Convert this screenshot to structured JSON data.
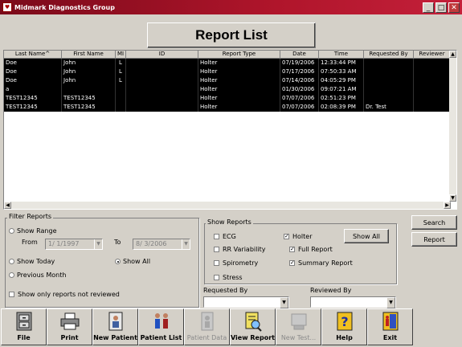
{
  "window": {
    "title": "Midmark Diagnostics Group"
  },
  "page_title": "Report List",
  "grid": {
    "columns": [
      "Last Name^",
      "First Name",
      "MI",
      "ID",
      "Report Type",
      "Date",
      "Time",
      "Requested By",
      "Reviewer"
    ],
    "rows": [
      [
        "Doe",
        "John",
        "L",
        "",
        "Holter",
        "07/19/2006",
        "12:33:44 PM",
        "",
        ""
      ],
      [
        "Doe",
        "John",
        "L",
        "",
        "Holter",
        "07/17/2006",
        "07:50:33 AM",
        "",
        ""
      ],
      [
        "Doe",
        "John",
        "L",
        "",
        "Holter",
        "07/14/2006",
        "04:05:29 PM",
        "",
        ""
      ],
      [
        "a",
        "",
        "",
        "",
        "Holter",
        "01/30/2006",
        "09:07:21 AM",
        "",
        ""
      ],
      [
        "TEST12345",
        "TEST12345",
        "",
        "",
        "Holter",
        "07/07/2006",
        "02:51:23 PM",
        "",
        ""
      ],
      [
        "TEST12345",
        "TEST12345",
        "",
        "",
        "Holter",
        "07/07/2006",
        "02:08:39 PM",
        "Dr. Test",
        ""
      ]
    ]
  },
  "filter": {
    "legend": "Filter Reports",
    "show_range": "Show Range",
    "from_label": "From",
    "from_value": "1/ 1/1997",
    "to_label": "To",
    "to_value": "8/ 3/2006",
    "show_today": "Show Today",
    "show_all": "Show All",
    "previous_month": "Previous Month",
    "not_reviewed": "Show only reports not reviewed"
  },
  "show_reports": {
    "legend": "Show Reports",
    "ecg": "ECG",
    "rr": "RR Variability",
    "spirometry": "Spirometry",
    "stress": "Stress",
    "holter": "Holter",
    "full_report": "Full Report",
    "summary_report": "Summary Report",
    "show_all_button": "Show All"
  },
  "requested_by": {
    "label": "Requested By",
    "value": ""
  },
  "reviewed_by": {
    "label": "Reviewed By",
    "value": ""
  },
  "side_buttons": {
    "search": "Search",
    "report": "Report"
  },
  "toolbar": {
    "file": "File",
    "print": "Print",
    "new_patient": "New Patient",
    "patient_list": "Patient List",
    "patient_data": "Patient Data",
    "view_report": "View Report",
    "new_test": "New Test...",
    "help": "Help",
    "exit": "Exit"
  }
}
